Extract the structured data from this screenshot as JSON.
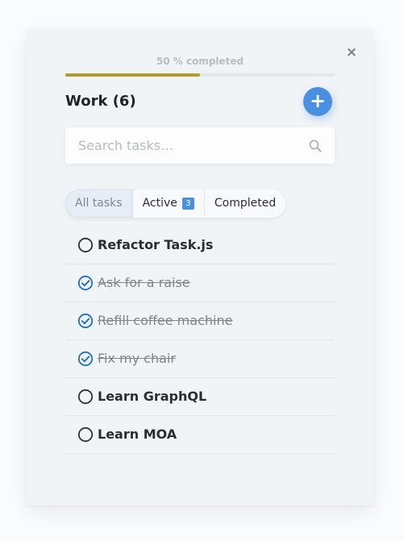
{
  "progress": {
    "label": "50 % completed",
    "fraction": 0.5,
    "fill_color": "#b59a2c"
  },
  "close": {
    "symbol": "×"
  },
  "list_title": "Work (6)",
  "add_button": {
    "symbol": "+"
  },
  "search": {
    "placeholder": "Search tasks…",
    "value": "",
    "icon": "search-icon"
  },
  "tabs": [
    {
      "label": "All tasks",
      "selected": true
    },
    {
      "label": "Active",
      "badge": "3",
      "selected": false
    },
    {
      "label": "Completed",
      "selected": false
    }
  ],
  "tasks": [
    {
      "label": "Refactor Task.js",
      "completed": false
    },
    {
      "label": "Ask for a raise",
      "completed": true
    },
    {
      "label": "Refill coffee machine",
      "completed": true
    },
    {
      "label": "Fix my chair",
      "completed": true
    },
    {
      "label": "Learn GraphQL",
      "completed": false
    },
    {
      "label": "Learn MOA",
      "completed": false
    }
  ],
  "colors": {
    "accent": "#4a90e2",
    "progress": "#b59a2c"
  }
}
